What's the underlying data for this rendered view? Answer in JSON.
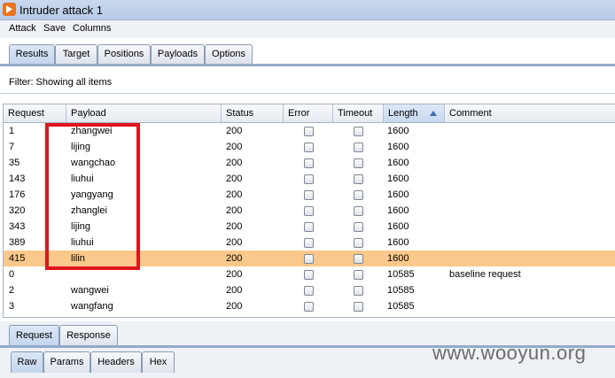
{
  "window": {
    "title": "Intruder attack 1"
  },
  "menu": [
    "Attack",
    "Save",
    "Columns"
  ],
  "main_tabs": [
    "Results",
    "Target",
    "Positions",
    "Payloads",
    "Options"
  ],
  "filter": {
    "text": "Filter:  Showing all items"
  },
  "table": {
    "columns": [
      "Request",
      "Payload",
      "Status",
      "Error",
      "Timeout",
      "Length",
      "Comment"
    ],
    "sorted_column": "Length",
    "rows": [
      {
        "request": "1",
        "payload": "zhangwei",
        "status": "200",
        "length": "1600",
        "comment": ""
      },
      {
        "request": "7",
        "payload": "lijing",
        "status": "200",
        "length": "1600",
        "comment": ""
      },
      {
        "request": "35",
        "payload": "wangchao",
        "status": "200",
        "length": "1600",
        "comment": ""
      },
      {
        "request": "143",
        "payload": "liuhui",
        "status": "200",
        "length": "1600",
        "comment": ""
      },
      {
        "request": "176",
        "payload": "yangyang",
        "status": "200",
        "length": "1600",
        "comment": ""
      },
      {
        "request": "320",
        "payload": "zhanglei",
        "status": "200",
        "length": "1600",
        "comment": ""
      },
      {
        "request": "343",
        "payload": "lijing",
        "status": "200",
        "length": "1600",
        "comment": ""
      },
      {
        "request": "389",
        "payload": "liuhui",
        "status": "200",
        "length": "1600",
        "comment": ""
      },
      {
        "request": "415",
        "payload": "lilin",
        "status": "200",
        "length": "1600",
        "comment": "",
        "selected": true
      },
      {
        "request": "0",
        "payload": "",
        "status": "200",
        "length": "10585",
        "comment": "baseline request"
      },
      {
        "request": "2",
        "payload": "wangwei",
        "status": "200",
        "length": "10585",
        "comment": ""
      },
      {
        "request": "3",
        "payload": "wangfang",
        "status": "200",
        "length": "10585",
        "comment": ""
      }
    ]
  },
  "detail_tabs": [
    "Request",
    "Response"
  ],
  "view_tabs": [
    "Raw",
    "Params",
    "Headers",
    "Hex"
  ],
  "watermark": "www.wooyun.org",
  "colors": {
    "selected_row": "#f9c88a",
    "highlight_box": "#e0141c"
  }
}
